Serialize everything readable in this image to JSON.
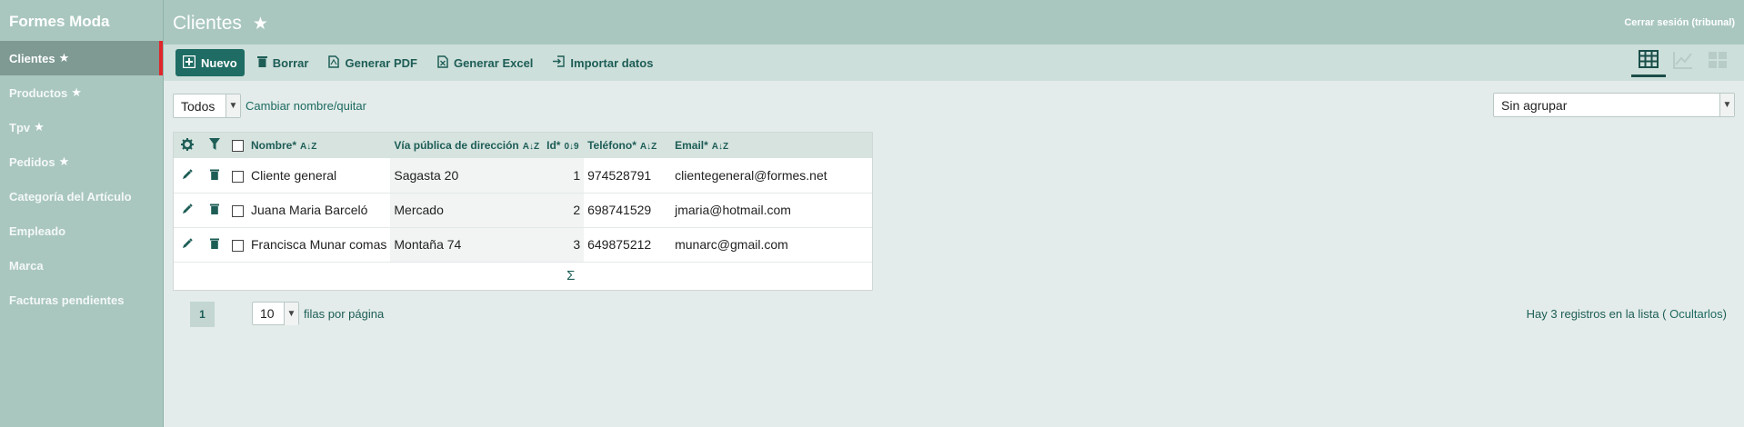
{
  "app": {
    "brand": "Formes Moda"
  },
  "sidebar": {
    "items": [
      {
        "label": "Clientes",
        "star": "★"
      },
      {
        "label": "Productos",
        "star": "★"
      },
      {
        "label": "Tpv",
        "star": "★"
      },
      {
        "label": "Pedidos",
        "star": "★"
      },
      {
        "label": "Categoría del Artículo"
      },
      {
        "label": "Empleado"
      },
      {
        "label": "Marca"
      },
      {
        "label": "Facturas pendientes"
      }
    ]
  },
  "header": {
    "title": "Clientes",
    "star": "★",
    "logout": "Cerrar sesión (tribunal)"
  },
  "toolbar": {
    "new_label": "Nuevo",
    "delete_label": "Borrar",
    "pdf_label": "Generar PDF",
    "excel_label": "Generar Excel",
    "import_label": "Importar datos"
  },
  "filter": {
    "selected": "Todos",
    "rename_link": "Cambiar nombre/quitar"
  },
  "grouping": {
    "selected": "Sin agrupar"
  },
  "table": {
    "columns": {
      "name": "Nombre*",
      "street": "Vía pública de dirección",
      "id": "Id*",
      "phone": "Teléfono*",
      "email": "Email*"
    },
    "rows": [
      {
        "name": "Cliente general",
        "street": "Sagasta 20",
        "id": "1",
        "phone": "974528791",
        "email": "clientegeneral@formes.net"
      },
      {
        "name": "Juana Maria Barceló",
        "street": "Mercado",
        "id": "2",
        "phone": "698741529",
        "email": "jmaria@hotmail.com"
      },
      {
        "name": "Francisca Munar comas",
        "street": "Montaña 74",
        "id": "3",
        "phone": "649875212",
        "email": "munarc@gmail.com"
      }
    ],
    "sum_symbol": "Σ"
  },
  "pagination": {
    "current_page": "1",
    "rows_per_page": "10",
    "rows_label": "filas por página",
    "records_text": "Hay 3 registros en la lista (",
    "hide_link": "Ocultarlos",
    "records_close": ")"
  },
  "colors": {
    "accent": "#1e6c64",
    "sidebar": "#a9c7bf",
    "active_marker": "#e0262b"
  }
}
